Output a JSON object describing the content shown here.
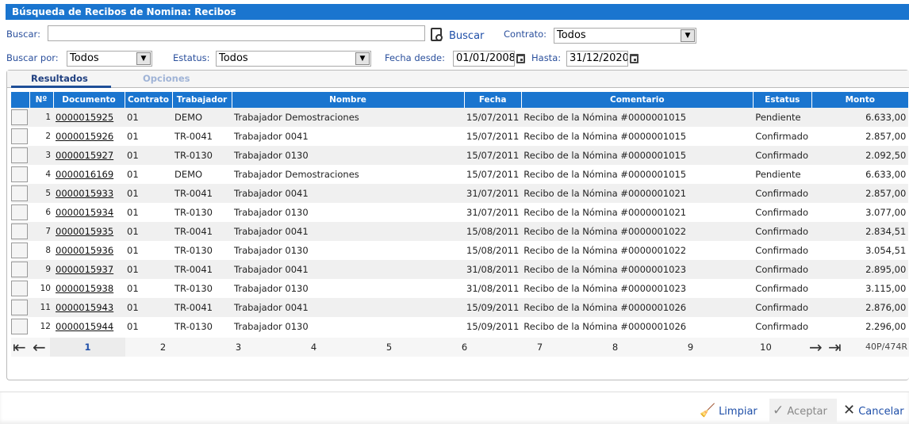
{
  "title": "Búsqueda de Recibos de Nomina: Recibos",
  "filters": {
    "buscar_label": "Buscar:",
    "buscar_value": "",
    "buscar_button": "Buscar",
    "contrato_label": "Contrato:",
    "contrato_value": "Todos",
    "buscar_por_label": "Buscar por:",
    "buscar_por_value": "Todos",
    "estatus_label": "Estatus:",
    "estatus_value": "Todos",
    "fecha_desde_label": "Fecha desde:",
    "fecha_desde_value": "01/01/2008",
    "hasta_label": "Hasta:",
    "hasta_value": "31/12/2020"
  },
  "tabs": [
    {
      "label": "Resultados",
      "active": true
    },
    {
      "label": "Opciones",
      "active": false
    }
  ],
  "columns": [
    "Nº",
    "Documento",
    "Contrato",
    "Trabajador",
    "Nombre",
    "Fecha",
    "Comentario",
    "Estatus",
    "Monto"
  ],
  "rows": [
    [
      "1",
      "0000015925",
      "01",
      "DEMO",
      "Trabajador Demostraciones",
      "15/07/2011",
      "Recibo de la Nómina #0000001015",
      "Pendiente",
      "6.633,00"
    ],
    [
      "2",
      "0000015926",
      "01",
      "TR-0041",
      "Trabajador 0041",
      "15/07/2011",
      "Recibo de la Nómina #0000001015",
      "Confirmado",
      "2.857,00"
    ],
    [
      "3",
      "0000015927",
      "01",
      "TR-0130",
      "Trabajador 0130",
      "15/07/2011",
      "Recibo de la Nómina #0000001015",
      "Confirmado",
      "2.092,50"
    ],
    [
      "4",
      "0000016169",
      "01",
      "DEMO",
      "Trabajador Demostraciones",
      "15/07/2011",
      "Recibo de la Nómina #0000001015",
      "Pendiente",
      "6.633,00"
    ],
    [
      "5",
      "0000015933",
      "01",
      "TR-0041",
      "Trabajador 0041",
      "31/07/2011",
      "Recibo de la Nómina #0000001021",
      "Confirmado",
      "2.857,00"
    ],
    [
      "6",
      "0000015934",
      "01",
      "TR-0130",
      "Trabajador 0130",
      "31/07/2011",
      "Recibo de la Nómina #0000001021",
      "Confirmado",
      "3.077,00"
    ],
    [
      "7",
      "0000015935",
      "01",
      "TR-0041",
      "Trabajador 0041",
      "15/08/2011",
      "Recibo de la Nómina #0000001022",
      "Confirmado",
      "2.834,51"
    ],
    [
      "8",
      "0000015936",
      "01",
      "TR-0130",
      "Trabajador 0130",
      "15/08/2011",
      "Recibo de la Nómina #0000001022",
      "Confirmado",
      "3.054,51"
    ],
    [
      "9",
      "0000015937",
      "01",
      "TR-0041",
      "Trabajador 0041",
      "31/08/2011",
      "Recibo de la Nómina #0000001023",
      "Confirmado",
      "2.895,00"
    ],
    [
      "10",
      "0000015938",
      "01",
      "TR-0130",
      "Trabajador 0130",
      "31/08/2011",
      "Recibo de la Nómina #0000001023",
      "Confirmado",
      "3.115,00"
    ],
    [
      "11",
      "0000015943",
      "01",
      "TR-0041",
      "Trabajador 0041",
      "15/09/2011",
      "Recibo de la Nómina #0000001026",
      "Confirmado",
      "2.876,00"
    ],
    [
      "12",
      "0000015944",
      "01",
      "TR-0130",
      "Trabajador 0130",
      "15/09/2011",
      "Recibo de la Nómina #0000001026",
      "Confirmado",
      "2.296,00"
    ]
  ],
  "pager": {
    "pages": [
      "1",
      "2",
      "3",
      "4",
      "5",
      "6",
      "7",
      "8",
      "9",
      "10"
    ],
    "current": "1",
    "summary": "40P/474R"
  },
  "footer": {
    "limpiar": "Limpiar",
    "aceptar": "Aceptar",
    "cancelar": "Cancelar"
  },
  "colors": {
    "accent": "#1a75cf",
    "link": "#1f4fa8"
  }
}
